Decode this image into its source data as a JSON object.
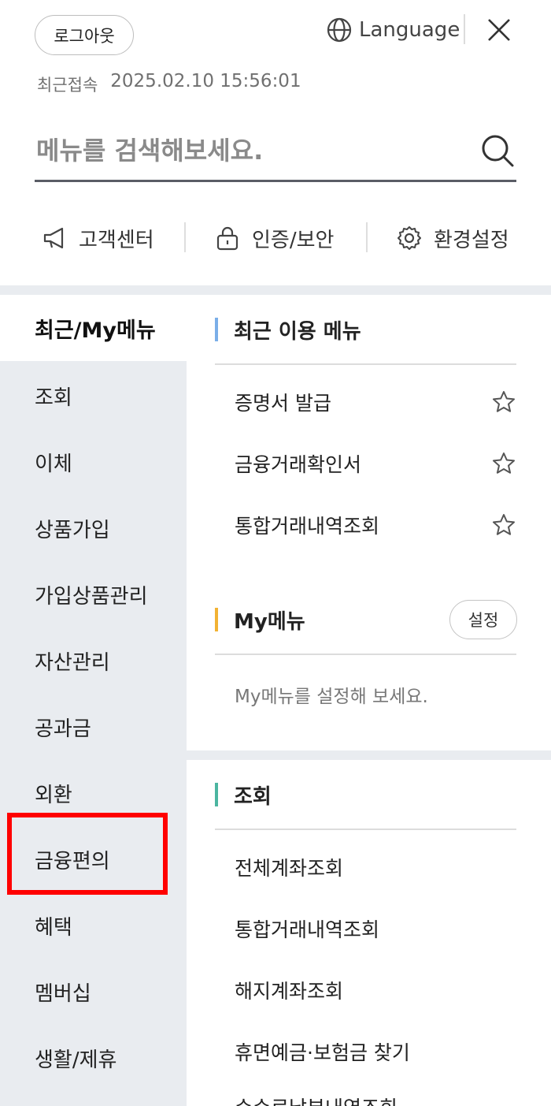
{
  "header": {
    "logout_label": "로그아웃",
    "language_label": "Language",
    "last_login_label": "최근접속",
    "last_login_value": "2025.02.10 15:56:01"
  },
  "search": {
    "placeholder": "메뉴를 검색해보세요."
  },
  "quick_links": [
    {
      "label": "고객센터",
      "icon": "megaphone-icon"
    },
    {
      "label": "인증/보안",
      "icon": "lock-icon"
    },
    {
      "label": "환경설정",
      "icon": "gear-icon"
    }
  ],
  "side_menu": {
    "items": [
      {
        "label": "최근/My메뉴",
        "active": true
      },
      {
        "label": "조회"
      },
      {
        "label": "이체"
      },
      {
        "label": "상품가입"
      },
      {
        "label": "가입상품관리"
      },
      {
        "label": "자산관리"
      },
      {
        "label": "공과금"
      },
      {
        "label": "외환"
      },
      {
        "label": "금융편의"
      },
      {
        "label": "혜택"
      },
      {
        "label": "멤버십"
      },
      {
        "label": "생활/제휴"
      }
    ]
  },
  "recent": {
    "title": "최근 이용 메뉴",
    "bar_color": "#7aaee8",
    "items": [
      "증명서 발급",
      "금융거래확인서",
      "통합거래내역조회"
    ]
  },
  "mymenu": {
    "title": "My메뉴",
    "bar_color": "#f2b233",
    "settings_label": "설정",
    "hint": "My메뉴를 설정해 보세요."
  },
  "inquiry": {
    "title": "조회",
    "bar_color": "#4bb5a0",
    "items": [
      "전체계좌조회",
      "통합거래내역조회",
      "해지계좌조회",
      "휴면예금·보험금 찾기",
      "수수료납부내역조회"
    ]
  }
}
